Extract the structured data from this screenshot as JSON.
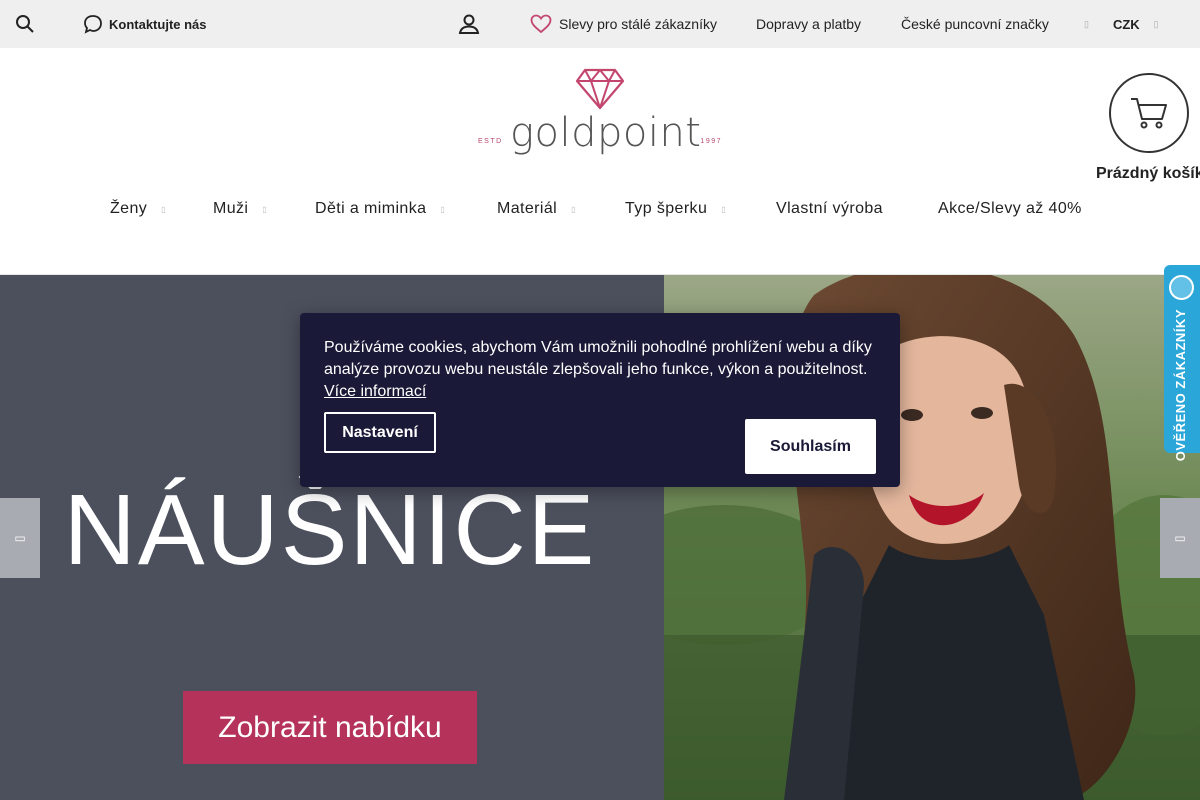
{
  "topbar": {
    "contact_label": "Kontaktujte nás",
    "discounts_label": "Slevy pro stálé zákazníky",
    "shipping_label": "Dopravy a platby",
    "hallmarks_label": "České puncovní značky",
    "currency_label": "CZK"
  },
  "logo": {
    "estd": "ESTD",
    "name": "goldpoint",
    "year": "1997"
  },
  "cart": {
    "label": "Prázdný košík"
  },
  "nav": {
    "items": [
      {
        "label": "Ženy"
      },
      {
        "label": "Muži"
      },
      {
        "label": "Děti a miminka"
      },
      {
        "label": "Materiál"
      },
      {
        "label": "Typ šperku"
      },
      {
        "label": "Vlastní výroba"
      },
      {
        "label": "Akce/Slevy až 40%"
      }
    ]
  },
  "hero": {
    "subtitle": "Zl",
    "title": "NÁUŠNICE",
    "button_label": "Zobrazit nabídku"
  },
  "badge": {
    "text": "OVĚŘENO ZÁKAZNÍKY"
  },
  "cookie": {
    "text": "Používáme cookies, abychom Vám umožnili pohodlné prohlížení webu a díky analýze provozu webu neustále zlepšovali jeho funkce, výkon a použitelnost.",
    "more_label": "Více informací",
    "settings_label": "Nastavení",
    "accept_label": "Souhlasím"
  },
  "colors": {
    "brand": "#b5335b",
    "logo_pink": "#c2466e",
    "hero_panel": "#4c505d",
    "cookie_bg": "#1a1937",
    "badge": "#2aa6d8"
  }
}
